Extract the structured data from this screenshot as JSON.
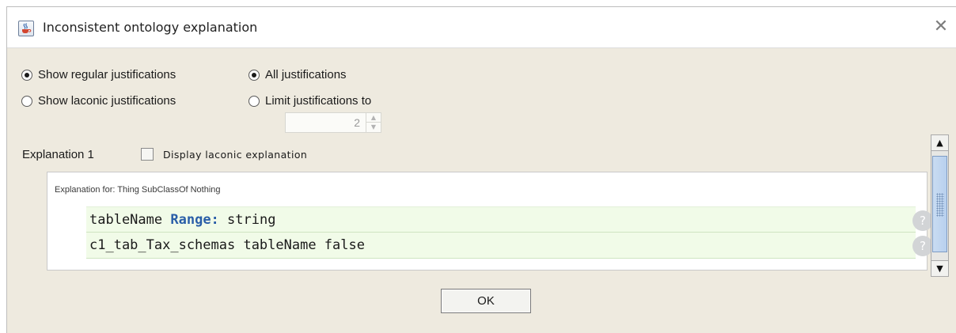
{
  "window": {
    "title": "Inconsistent ontology explanation",
    "close_glyph": "✕",
    "app_icon": "java-coffee-cup-icon"
  },
  "justification_mode": {
    "regular": {
      "label": "Show regular justifications",
      "checked": true
    },
    "laconic": {
      "label": "Show laconic justifications",
      "checked": false
    }
  },
  "justification_limit": {
    "all": {
      "label": "All justifications",
      "checked": true
    },
    "limit": {
      "label": "Limit justifications to",
      "checked": false
    },
    "value": "2",
    "enabled": false
  },
  "explanation": {
    "label": "Explanation 1",
    "laconic_checkbox_label": "Display laconic explanation",
    "laconic_checked": false,
    "header": "Explanation for: Thing SubClassOf Nothing",
    "axioms": [
      {
        "subject": "tableName",
        "keyword": "Range:",
        "object": "string",
        "help": "?"
      },
      {
        "text": "c1_tab_Tax_schemas tableName false",
        "help": "?"
      }
    ]
  },
  "scrollbar": {
    "up_glyph": "▲",
    "down_glyph": "▼"
  },
  "buttons": {
    "ok": "OK"
  },
  "colors": {
    "dialog_bg": "#eeeadf",
    "axiom_row_bg": "#f1fbe8",
    "keyword": "#2a5ea8",
    "scroll_thumb": "#b8d0ee"
  }
}
